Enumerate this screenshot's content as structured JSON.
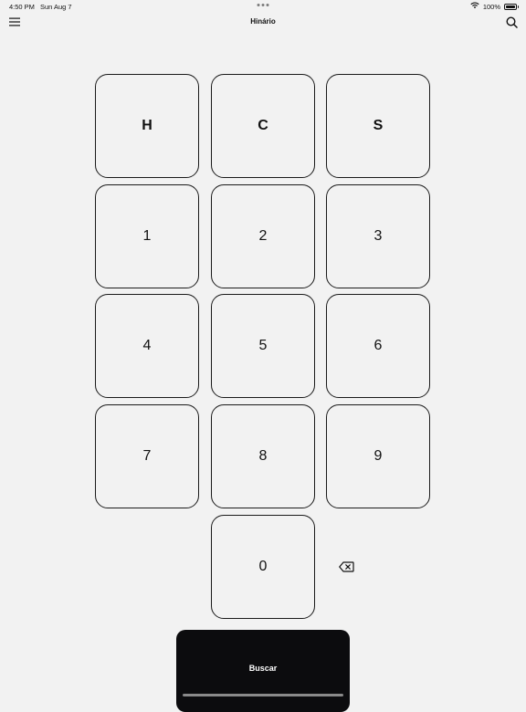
{
  "status_bar": {
    "time": "4:50 PM",
    "date": "Sun Aug 7",
    "battery_text": "100%",
    "battery_level": 1.0
  },
  "nav": {
    "title": "Hinário",
    "menu_icon": "hamburger-menu-icon",
    "search_icon": "search-icon"
  },
  "keypad": {
    "letters": [
      "H",
      "C",
      "S"
    ],
    "digits": [
      "1",
      "2",
      "3",
      "4",
      "5",
      "6",
      "7",
      "8",
      "9",
      "0"
    ],
    "backspace_icon": "delete-backward-icon"
  },
  "action": {
    "search_label": "Buscar"
  },
  "colors": {
    "background": "#f2f2f2",
    "button_dark": "#0c0c0e",
    "border": "#1a1a1a"
  }
}
